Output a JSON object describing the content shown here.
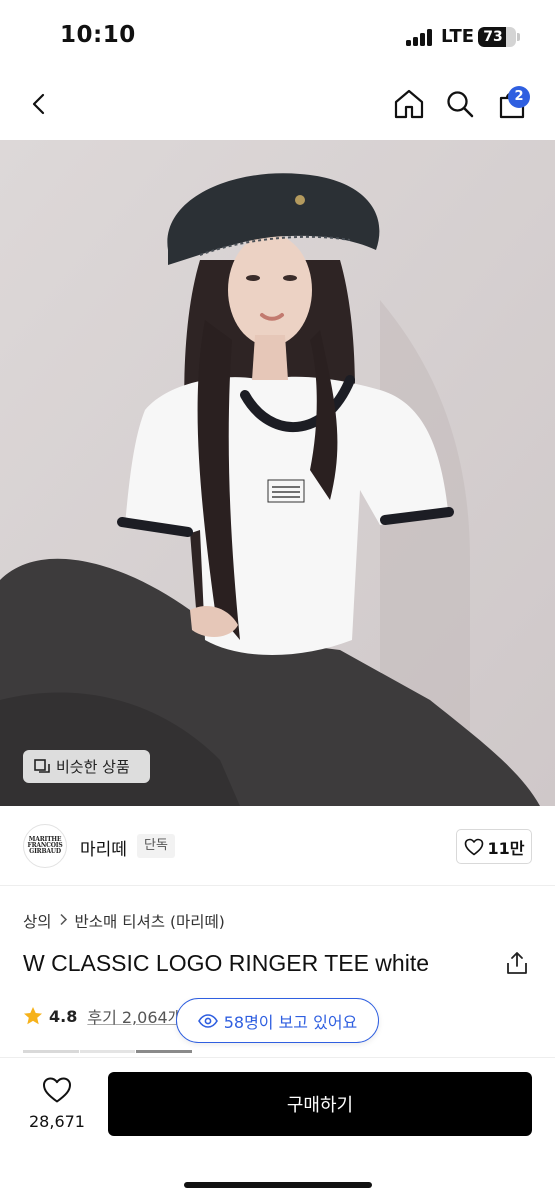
{
  "status": {
    "time": "10:10",
    "network": "LTE",
    "battery_level": "73",
    "battery_fraction": 0.73
  },
  "nav": {
    "icons": [
      "chevron-left-icon",
      "home-icon",
      "search-icon",
      "cart-icon"
    ],
    "cart_count": "2"
  },
  "hero": {
    "similar_button_label": "비슷한 상품",
    "similar_icon": "similar-items-icon"
  },
  "brand": {
    "logo_text": [
      "MARITHE",
      "FRANCOIS",
      "GIRBAUD"
    ],
    "name": "마리떼",
    "tag": "단독",
    "like_count": "11만"
  },
  "product": {
    "breadcrumb": [
      "상의",
      "반소매 티셔츠 (마리떼)"
    ],
    "title": "W CLASSIC LOGO RINGER TEE white",
    "rating": "4.8",
    "review_label": "후기 2,064개",
    "viewers_label": "58명이 보고 있어요"
  },
  "colors": {
    "accent": "#2f5fe0",
    "star": "#f6b21b",
    "buy_bg": "#000000"
  },
  "bottom": {
    "wishlist_count": "28,671",
    "buy_label": "구매하기"
  }
}
